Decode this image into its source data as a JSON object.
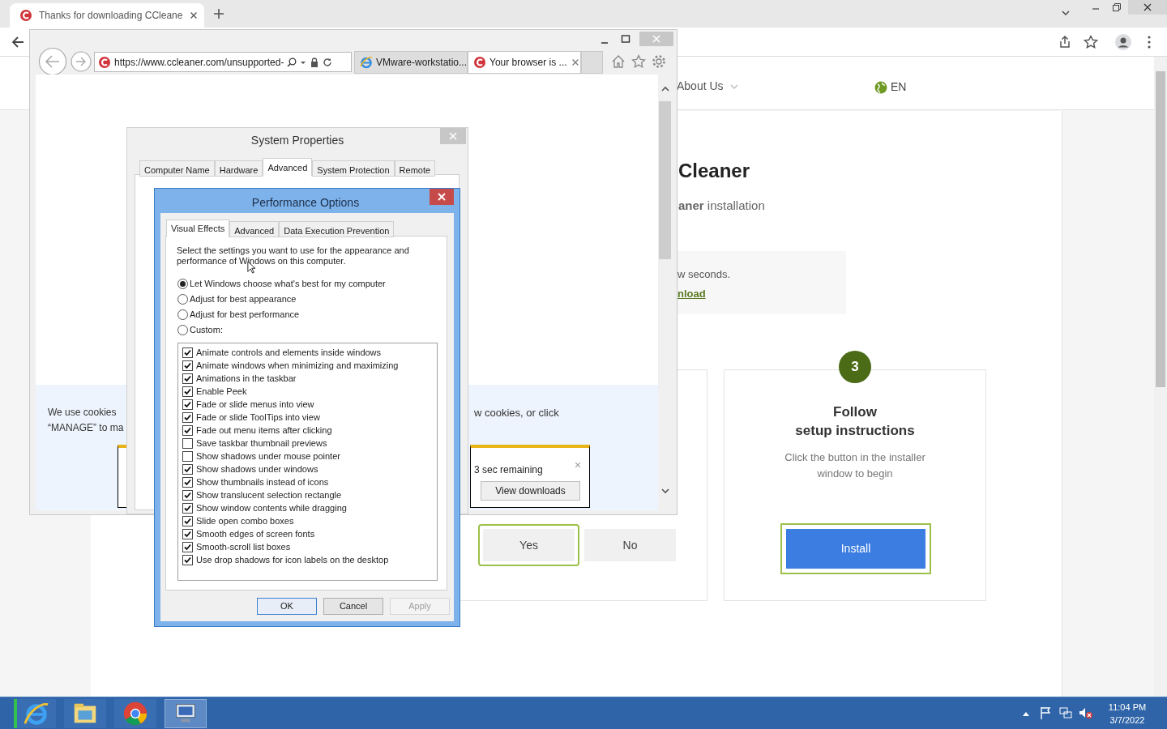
{
  "chrome": {
    "tab": {
      "title": "Thanks for downloading CCleane",
      "selected": true
    }
  },
  "site": {
    "nav_item": "About Us",
    "language": "EN",
    "heading": "Cleaner",
    "subheading": "**aner** installation",
    "notice_text": "w seconds.",
    "notice_link": "nload",
    "cookie_banner": [
      "We use cookies",
      "“MANAGE” to ma",
      "w cookies, or click"
    ],
    "download_bar": {
      "status": "3 sec remaining",
      "button": "View downloads"
    },
    "prompt_buttons": [
      {
        "label": "Yes",
        "focused": true
      },
      {
        "label": "No",
        "focused": false
      }
    ],
    "step": {
      "number": "3",
      "title": "Follow\nsetup instructions",
      "description": "Click the button in the installer window to begin",
      "button": {
        "label": "Install",
        "focused": true
      }
    }
  },
  "ie": {
    "address": "https://www.ccleaner.com/unsupported-",
    "tabs": [
      {
        "title": "VMware-workstatio...",
        "selected": false,
        "kind": "ie"
      },
      {
        "title": "Your browser is ...",
        "selected": true,
        "kind": "ccleaner"
      }
    ]
  },
  "system_properties": {
    "title": "System Properties",
    "tabs": [
      {
        "label": "Computer Name",
        "selected": false
      },
      {
        "label": "Hardware",
        "selected": false
      },
      {
        "label": "Advanced",
        "selected": true
      },
      {
        "label": "System Protection",
        "selected": false
      },
      {
        "label": "Remote",
        "selected": false
      }
    ]
  },
  "performance_options": {
    "title": "Performance Options",
    "tabs": [
      {
        "label": "Visual Effects",
        "selected": true
      },
      {
        "label": "Advanced",
        "selected": false
      },
      {
        "label": "Data Execution Prevention",
        "selected": false
      }
    ],
    "description": "Select the settings you want to use for the appearance and performance of Windows on this computer.",
    "options": [
      {
        "label": "Let Windows choose what's best for my computer",
        "selected": true
      },
      {
        "label": "Adjust for best appearance",
        "selected": false
      },
      {
        "label": "Adjust for best performance",
        "selected": false
      },
      {
        "label": "Custom:",
        "selected": false
      }
    ],
    "effects": [
      {
        "label": "Animate controls and elements inside windows",
        "checked": true
      },
      {
        "label": "Animate windows when minimizing and maximizing",
        "checked": true
      },
      {
        "label": "Animations in the taskbar",
        "checked": true
      },
      {
        "label": "Enable Peek",
        "checked": true
      },
      {
        "label": "Fade or slide menus into view",
        "checked": true
      },
      {
        "label": "Fade or slide ToolTips into view",
        "checked": true
      },
      {
        "label": "Fade out menu items after clicking",
        "checked": true
      },
      {
        "label": "Save taskbar thumbnail previews",
        "checked": false
      },
      {
        "label": "Show shadows under mouse pointer",
        "checked": false
      },
      {
        "label": "Show shadows under windows",
        "checked": true
      },
      {
        "label": "Show thumbnails instead of icons",
        "checked": true
      },
      {
        "label": "Show translucent selection rectangle",
        "checked": true
      },
      {
        "label": "Show window contents while dragging",
        "checked": true
      },
      {
        "label": "Slide open combo boxes",
        "checked": true
      },
      {
        "label": "Smooth edges of screen fonts",
        "checked": true
      },
      {
        "label": "Smooth-scroll list boxes",
        "checked": true
      },
      {
        "label": "Use drop shadows for icon labels on the desktop",
        "checked": true
      }
    ],
    "buttons": [
      {
        "label": "OK",
        "disabled": false
      },
      {
        "label": "Cancel",
        "disabled": false
      },
      {
        "label": "Apply",
        "disabled": true
      }
    ]
  },
  "taskbar": {
    "apps": [
      {
        "kind": "ie",
        "selected": false
      },
      {
        "kind": "explorer",
        "selected": false
      },
      {
        "kind": "chrome",
        "selected": false
      },
      {
        "kind": "system",
        "selected": true
      }
    ],
    "time": "11:04 PM",
    "date": "3/7/2022"
  }
}
